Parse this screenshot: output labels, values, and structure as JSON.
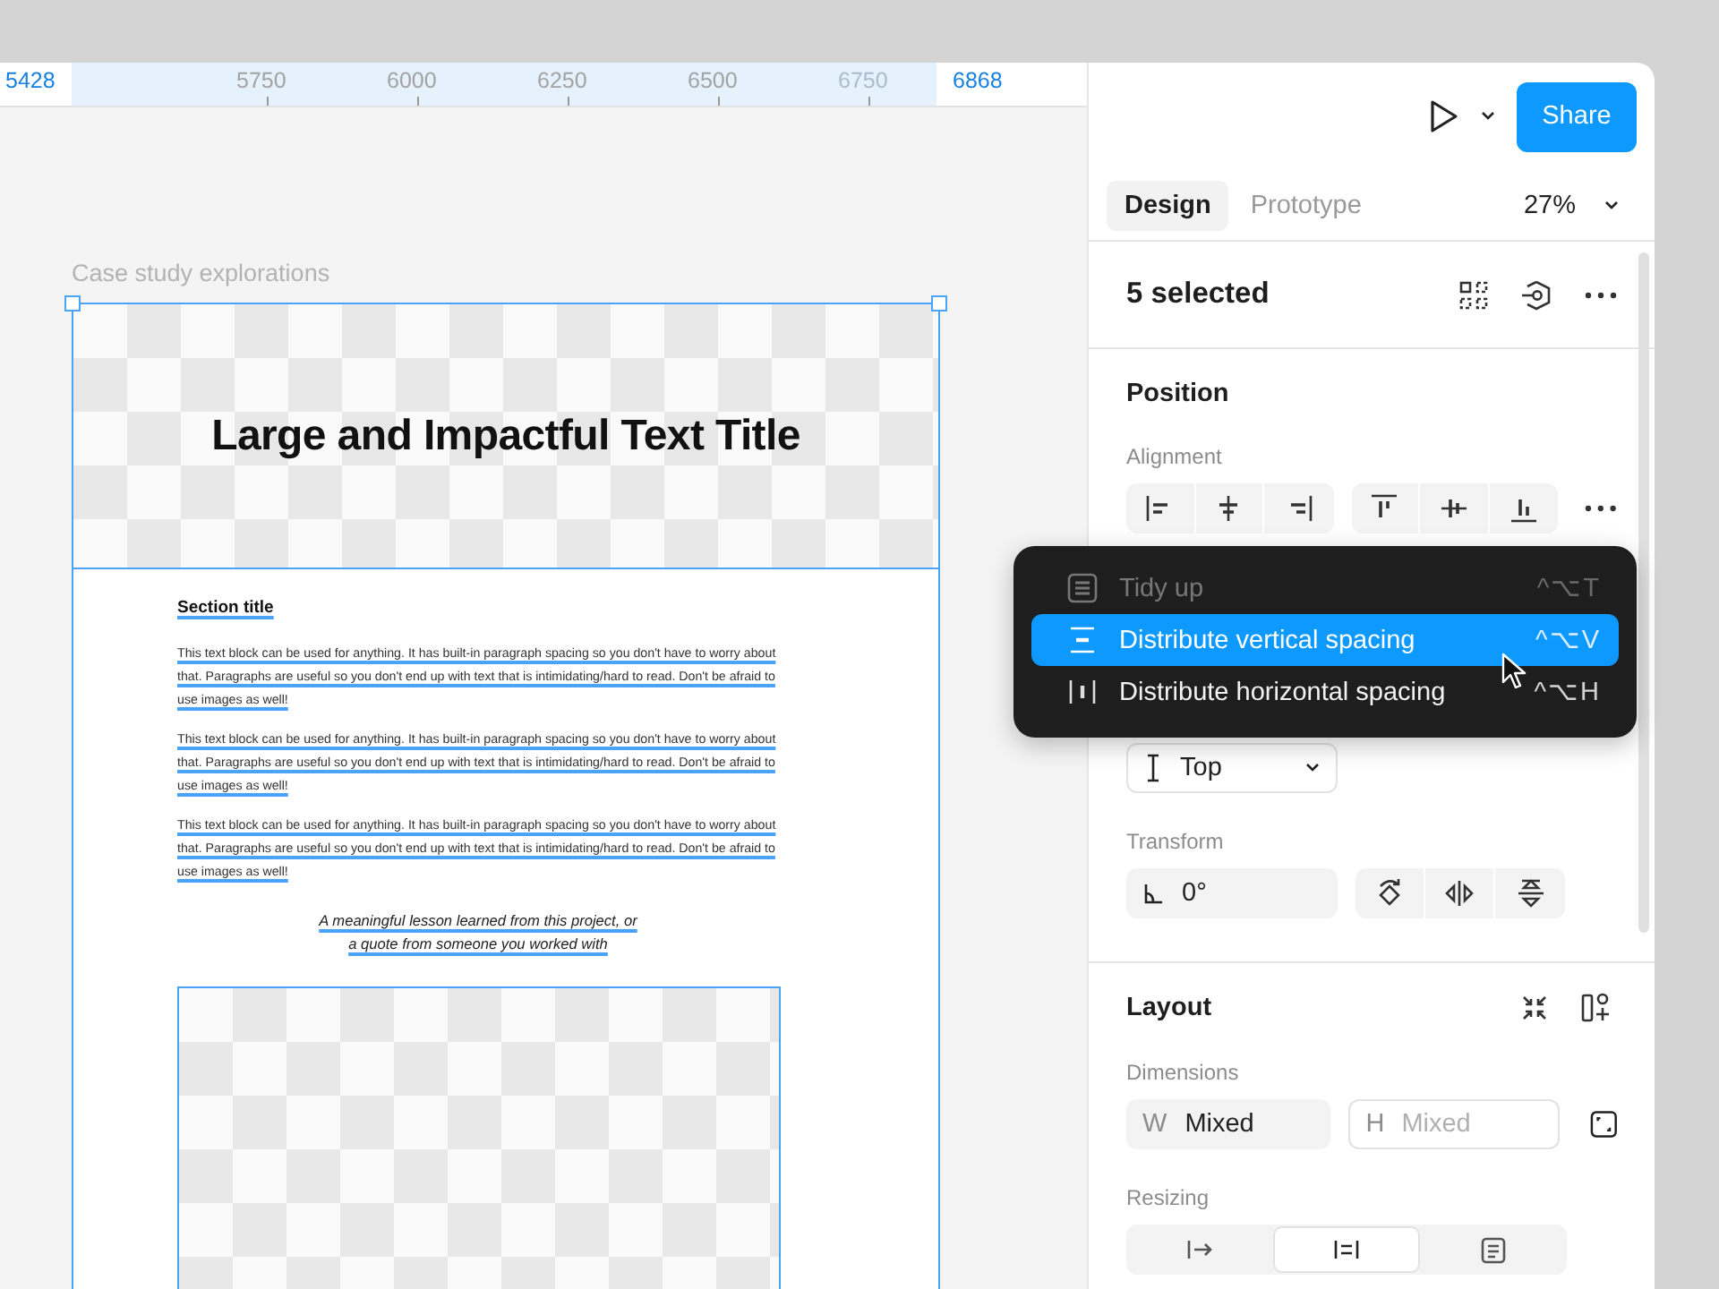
{
  "ruler": {
    "start": "5428",
    "ticks": [
      {
        "label": "5750",
        "faded": false
      },
      {
        "label": "6000",
        "faded": false
      },
      {
        "label": "6250",
        "faded": false
      },
      {
        "label": "6500",
        "faded": false
      },
      {
        "label": "6750",
        "faded": true
      }
    ],
    "end": "6868"
  },
  "canvas": {
    "frame_label": "Case study explorations",
    "hero_title": "Large and Impactful Text Title",
    "section_title": "Section title",
    "paragraphs": [
      "This text block can be used for anything. It has built-in paragraph spacing so you don't have to worry about that. Paragraphs are useful so you don't end up with text that is intimidating/hard to read. Don't be afraid to use images as well!",
      "This text block can be used for anything. It has built-in paragraph spacing so you don't have to worry about that. Paragraphs are useful so you don't end up with text that is intimidating/hard to read. Don't be afraid to use images as well!",
      "This text block can be used for anything. It has built-in paragraph spacing so you don't have to worry about that. Paragraphs are useful so you don't end up with text that is intimidating/hard to read. Don't be afraid to use images as well!"
    ],
    "quote_lines": [
      "A meaningful lesson learned from this project, or",
      "a quote from someone you worked with"
    ]
  },
  "toolbar": {
    "share": "Share"
  },
  "panel_tabs": [
    {
      "label": "Design",
      "selected": true
    },
    {
      "label": "Prototype",
      "selected": false
    }
  ],
  "zoom": "27%",
  "selection": "5 selected",
  "position": {
    "title": "Position",
    "alignment_label": "Alignment",
    "vertical_constraint": "Top",
    "transform_label": "Transform",
    "rotation": "0°"
  },
  "menu": [
    {
      "label": "Tidy up",
      "shortcut": "^⌥T",
      "disabled": true,
      "selected": false
    },
    {
      "label": "Distribute vertical spacing",
      "shortcut": "^⌥V",
      "disabled": false,
      "selected": true
    },
    {
      "label": "Distribute horizontal spacing",
      "shortcut": "^⌥H",
      "disabled": false,
      "selected": false
    }
  ],
  "layout": {
    "title": "Layout",
    "dimensions_label": "Dimensions",
    "width_label": "W",
    "width": "Mixed",
    "height_label": "H",
    "height_placeholder": "Mixed",
    "resizing_label": "Resizing",
    "resizing_options": [
      {
        "selected": false
      },
      {
        "selected": true
      },
      {
        "selected": false
      }
    ]
  }
}
